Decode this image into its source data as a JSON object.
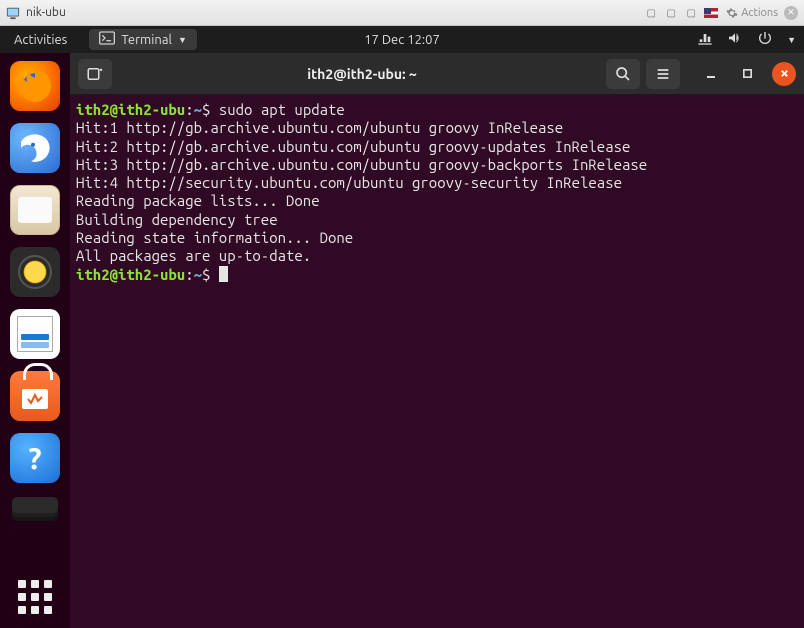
{
  "vm_title": "nik-ubu",
  "vm_actions_label": "Actions",
  "gnome": {
    "activities": "Activities",
    "app_label": "Terminal",
    "datetime": "17 Dec  12:07"
  },
  "terminal": {
    "title": "ith2@ith2-ubu: ~",
    "prompt_user": "ith2@ith2-ubu",
    "prompt_sep1": ":",
    "prompt_path": "~",
    "prompt_sep2": "$",
    "command": "sudo apt update",
    "lines": [
      "Hit:1 http://gb.archive.ubuntu.com/ubuntu groovy InRelease",
      "Hit:2 http://gb.archive.ubuntu.com/ubuntu groovy-updates InRelease",
      "Hit:3 http://gb.archive.ubuntu.com/ubuntu groovy-backports InRelease",
      "Hit:4 http://security.ubuntu.com/ubuntu groovy-security InRelease",
      "Reading package lists... Done",
      "Building dependency tree",
      "Reading state information... Done",
      "All packages are up-to-date."
    ]
  },
  "help_glyph": "?"
}
